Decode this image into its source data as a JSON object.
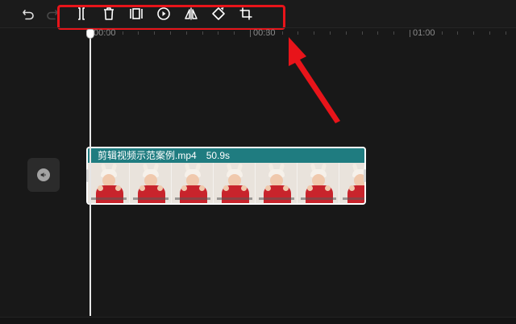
{
  "toolbar": {
    "tools": [
      {
        "name": "undo",
        "icon": "undo-icon"
      },
      {
        "name": "redo",
        "icon": "redo-icon"
      },
      {
        "name": "split",
        "icon": "split-icon"
      },
      {
        "name": "delete",
        "icon": "delete-icon"
      },
      {
        "name": "freeze-frame",
        "icon": "freeze-frame-icon"
      },
      {
        "name": "reverse",
        "icon": "reverse-icon"
      },
      {
        "name": "mirror",
        "icon": "mirror-icon"
      },
      {
        "name": "rotate",
        "icon": "rotate-icon"
      },
      {
        "name": "crop",
        "icon": "crop-icon"
      }
    ],
    "highlight_color": "#e8141a"
  },
  "ruler": {
    "labels": [
      "00:00",
      "00:30",
      "01:00"
    ]
  },
  "audio": {
    "icon": "volume-icon"
  },
  "clip": {
    "title": "剪辑视频示范案例.mp4",
    "duration": "50.9s",
    "header_color": "#1f7c80"
  },
  "annotation": {
    "arrow_color": "#e8141a"
  }
}
